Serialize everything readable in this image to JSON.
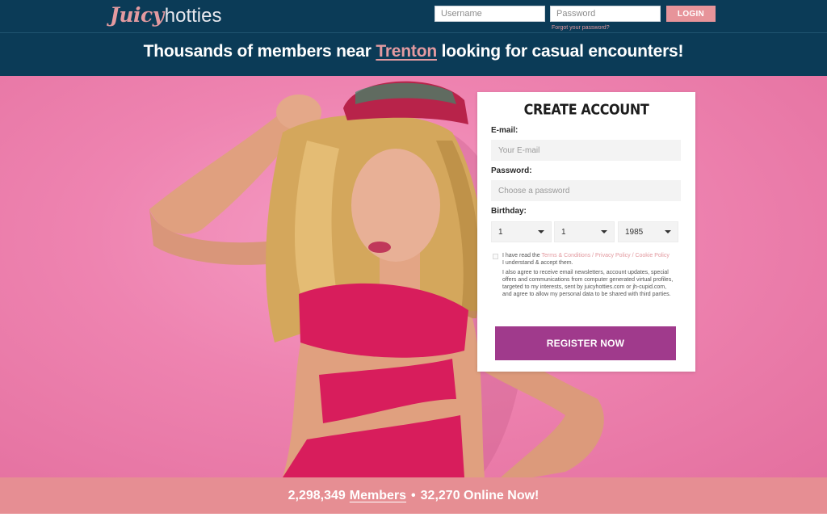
{
  "header": {
    "logo": {
      "part1": "Juicy",
      "part2": "hotties"
    },
    "login": {
      "username_placeholder": "Username",
      "password_placeholder": "Password",
      "button_label": "LOGIN",
      "forgot_link": "Forgot your password?"
    },
    "headline": {
      "prefix": "Thousands of members near ",
      "city": "Trenton",
      "suffix": " looking for casual encounters!"
    }
  },
  "form": {
    "title": "CREATE ACCOUNT",
    "email_label": "E-mail:",
    "email_placeholder": "Your E-mail",
    "password_label": "Password:",
    "password_placeholder": "Choose a password",
    "birthday_label": "Birthday:",
    "birthday": {
      "day": "1",
      "month": "1",
      "year": "1985"
    },
    "terms": {
      "prefix": "I have read the ",
      "link": "Terms & Conditions / Privacy Policy / Cookie Policy",
      "accept": "I understand & accept them.",
      "consent": "I also agree to receive email newsletters, account updates, special offers and communications from computer generated virtual profiles, targeted to my interests, sent by juicyhotties.com or jh-cupid.com, and agree to allow my personal data to be shared with third parties."
    },
    "register_label": "REGISTER NOW"
  },
  "stats": {
    "members_count": "2,298,349",
    "members_label": "Members",
    "separator": "•",
    "online_text": "32,270 Online Now!"
  },
  "colors": {
    "header_bg": "#0b3b57",
    "accent_pink": "#e39aa0",
    "hero_bg": "#ef86b0",
    "register_button": "#a03a8c",
    "stats_bar": "#e68e93"
  }
}
